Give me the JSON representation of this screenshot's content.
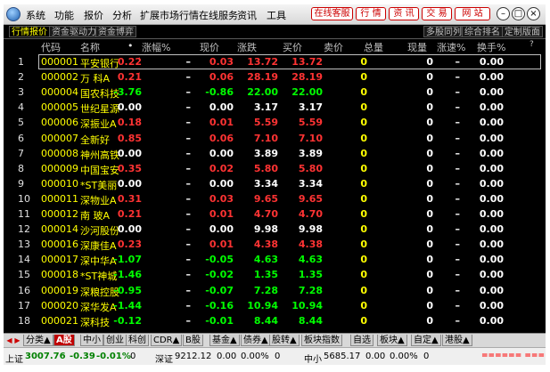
{
  "menu": {
    "items": [
      "系统",
      "功能",
      "报价",
      "分析",
      "扩展市场行情",
      "在线服务",
      "资讯",
      "工具"
    ],
    "red_buttons": [
      "在线客服",
      "行 情",
      "资 讯",
      "交 易",
      "网 站"
    ]
  },
  "tabs": {
    "left": [
      "行情报价",
      "资金驱动力",
      "资金博弈"
    ],
    "right": [
      "多股同列",
      "综合排名",
      "定制版面"
    ]
  },
  "columns": {
    "code": "代码",
    "name": "名称",
    "dot": "•",
    "change_pct": "涨幅%",
    "price": "现价",
    "change": "涨跌",
    "bid": "买价",
    "ask": "卖价",
    "volume": "总量",
    "cur_volume": "现量",
    "speed": "涨速%",
    "turnover": "换手%",
    "q": "?"
  },
  "colors": {
    "up": "#ff3333",
    "down": "#00ff00",
    "flat": "#ffffff",
    "yellow": "#ffff00"
  },
  "rows": [
    {
      "idx": "1",
      "code": "000001",
      "name": "平安银行",
      "mark": "·",
      "pct": "0.22",
      "price": "–",
      "chg": "0.03",
      "bid": "13.72",
      "ask": "13.72",
      "vol": "0",
      "cur": "0",
      "spd": "–",
      "turn": "0.00",
      "dir": "up"
    },
    {
      "idx": "2",
      "code": "000002",
      "name": "万 科A",
      "mark": "·",
      "pct": "0.21",
      "price": "–",
      "chg": "0.06",
      "bid": "28.19",
      "ask": "28.19",
      "vol": "0",
      "cur": "0",
      "spd": "–",
      "turn": "0.00",
      "dir": "up"
    },
    {
      "idx": "3",
      "code": "000004",
      "name": "国农科技",
      "mark": "",
      "pct": "-3.76",
      "price": "–",
      "chg": "-0.86",
      "bid": "22.00",
      "ask": "22.00",
      "vol": "0",
      "cur": "0",
      "spd": "–",
      "turn": "0.00",
      "dir": "down"
    },
    {
      "idx": "4",
      "code": "000005",
      "name": "世纪星源",
      "mark": "",
      "pct": "0.00",
      "price": "–",
      "chg": "0.00",
      "bid": "3.17",
      "ask": "3.17",
      "vol": "0",
      "cur": "0",
      "spd": "–",
      "turn": "0.00",
      "dir": "flat"
    },
    {
      "idx": "5",
      "code": "000006",
      "name": "深振业A",
      "mark": "·",
      "pct": "0.18",
      "price": "–",
      "chg": "0.01",
      "bid": "5.59",
      "ask": "5.59",
      "vol": "0",
      "cur": "0",
      "spd": "–",
      "turn": "0.00",
      "dir": "up"
    },
    {
      "idx": "6",
      "code": "000007",
      "name": "全新好",
      "mark": "",
      "pct": "0.85",
      "price": "–",
      "chg": "0.06",
      "bid": "7.10",
      "ask": "7.10",
      "vol": "0",
      "cur": "0",
      "spd": "–",
      "turn": "0.00",
      "dir": "up"
    },
    {
      "idx": "7",
      "code": "000008",
      "name": "神州高铁",
      "mark": "",
      "pct": "0.00",
      "price": "–",
      "chg": "0.00",
      "bid": "3.89",
      "ask": "3.89",
      "vol": "0",
      "cur": "0",
      "spd": "–",
      "turn": "0.00",
      "dir": "flat"
    },
    {
      "idx": "8",
      "code": "000009",
      "name": "中国宝安",
      "mark": "·",
      "pct": "0.35",
      "price": "–",
      "chg": "0.02",
      "bid": "5.80",
      "ask": "5.80",
      "vol": "0",
      "cur": "0",
      "spd": "–",
      "turn": "0.00",
      "dir": "up"
    },
    {
      "idx": "9",
      "code": "000010",
      "name": "*ST美丽",
      "mark": "",
      "pct": "0.00",
      "price": "–",
      "chg": "0.00",
      "bid": "3.34",
      "ask": "3.34",
      "vol": "0",
      "cur": "0",
      "spd": "–",
      "turn": "0.00",
      "dir": "flat"
    },
    {
      "idx": "10",
      "code": "000011",
      "name": "深物业A",
      "mark": "",
      "pct": "0.31",
      "price": "–",
      "chg": "0.03",
      "bid": "9.65",
      "ask": "9.65",
      "vol": "0",
      "cur": "0",
      "spd": "–",
      "turn": "0.00",
      "dir": "up"
    },
    {
      "idx": "11",
      "code": "000012",
      "name": "南 玻A",
      "mark": "·",
      "pct": "0.21",
      "price": "–",
      "chg": "0.01",
      "bid": "4.70",
      "ask": "4.70",
      "vol": "0",
      "cur": "0",
      "spd": "–",
      "turn": "0.00",
      "dir": "up"
    },
    {
      "idx": "12",
      "code": "000014",
      "name": "沙河股份",
      "mark": "",
      "pct": "0.00",
      "price": "–",
      "chg": "0.00",
      "bid": "9.98",
      "ask": "9.98",
      "vol": "0",
      "cur": "0",
      "spd": "–",
      "turn": "0.00",
      "dir": "flat"
    },
    {
      "idx": "13",
      "code": "000016",
      "name": "深康佳A",
      "mark": "·",
      "pct": "0.23",
      "price": "–",
      "chg": "0.01",
      "bid": "4.38",
      "ask": "4.38",
      "vol": "0",
      "cur": "0",
      "spd": "–",
      "turn": "0.00",
      "dir": "up"
    },
    {
      "idx": "14",
      "code": "000017",
      "name": "深中华A",
      "mark": "",
      "pct": "-1.07",
      "price": "–",
      "chg": "-0.05",
      "bid": "4.63",
      "ask": "4.63",
      "vol": "0",
      "cur": "0",
      "spd": "–",
      "turn": "0.00",
      "dir": "down"
    },
    {
      "idx": "15",
      "code": "000018",
      "name": "*ST神城",
      "mark": "",
      "pct": "-1.46",
      "price": "–",
      "chg": "-0.02",
      "bid": "1.35",
      "ask": "1.35",
      "vol": "0",
      "cur": "0",
      "spd": "–",
      "turn": "0.00",
      "dir": "down"
    },
    {
      "idx": "16",
      "code": "000019",
      "name": "深粮控股",
      "mark": "",
      "pct": "-0.95",
      "price": "–",
      "chg": "-0.07",
      "bid": "7.28",
      "ask": "7.28",
      "vol": "0",
      "cur": "0",
      "spd": "–",
      "turn": "0.00",
      "dir": "down"
    },
    {
      "idx": "17",
      "code": "000020",
      "name": "深华发A",
      "mark": "",
      "pct": "-1.44",
      "price": "–",
      "chg": "-0.16",
      "bid": "10.94",
      "ask": "10.94",
      "vol": "0",
      "cur": "0",
      "spd": "–",
      "turn": "0.00",
      "dir": "down"
    },
    {
      "idx": "18",
      "code": "000021",
      "name": "深科技",
      "mark": "",
      "pct": "-0.12",
      "price": "–",
      "chg": "-0.01",
      "bid": "8.44",
      "ask": "8.44",
      "vol": "0",
      "cur": "0",
      "spd": "–",
      "turn": "0.00",
      "dir": "down"
    }
  ],
  "bottom_tabs": [
    {
      "label": "分类▲",
      "active": false
    },
    {
      "label": "A股",
      "active": true
    },
    {
      "label": "中小",
      "active": false
    },
    {
      "label": "创业",
      "active": false
    },
    {
      "label": "科创",
      "active": false
    },
    {
      "label": "CDR▲",
      "active": false
    },
    {
      "label": "B股",
      "active": false
    },
    {
      "label": "基金▲",
      "active": false
    },
    {
      "label": "债券▲",
      "active": false
    },
    {
      "label": "股转▲",
      "active": false
    },
    {
      "label": "板块指数",
      "active": false
    },
    {
      "label": "自选",
      "active": false
    },
    {
      "label": "板块▲",
      "active": false
    },
    {
      "label": "自定▲",
      "active": false
    },
    {
      "label": "港股▲",
      "active": false
    }
  ],
  "status": {
    "sh_label": "上证",
    "sh_index": "3007.76",
    "sh_change": "-0.39",
    "sh_pct": "-0.01%",
    "sh_vol": "0",
    "sz_label": "深证",
    "sz_index": "9212.12",
    "sz_change": "0.00",
    "sz_pct": "0.00%",
    "sz_vol": "0",
    "zx_label": "中小",
    "zx_index": "5685.17",
    "zx_change": "0.00",
    "zx_pct": "0.00%",
    "zx_vol": "0",
    "indicator": "====== ======"
  }
}
